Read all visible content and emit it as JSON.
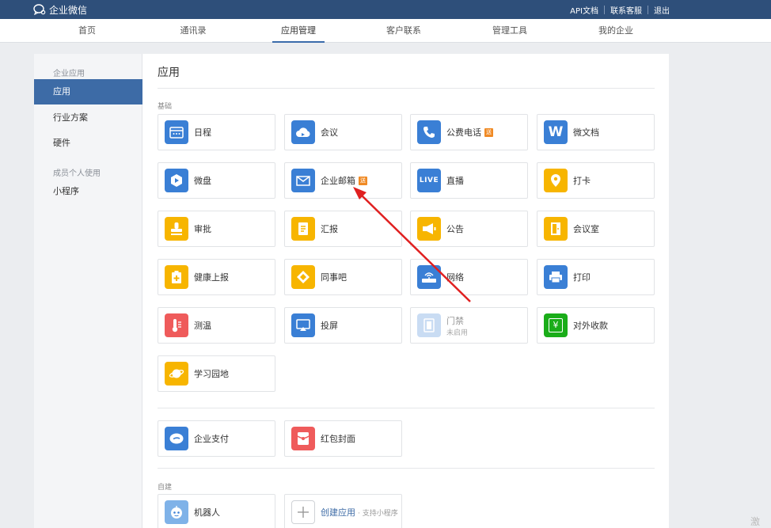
{
  "topbar": {
    "logo_text": "企业微信",
    "links": [
      "API文档",
      "联系客服",
      "退出"
    ]
  },
  "nav": {
    "tabs": [
      "首页",
      "通讯录",
      "应用管理",
      "客户联系",
      "管理工具",
      "我的企业"
    ],
    "active": "应用管理"
  },
  "sidebar": {
    "group1": "企业应用",
    "items1": [
      "应用",
      "行业方案",
      "硬件"
    ],
    "group2": "成员个人使用",
    "items2": [
      "小程序"
    ]
  },
  "content": {
    "title": "应用",
    "section_basic": "基础",
    "section_custom": "自建"
  },
  "apps": {
    "calendar": "日程",
    "meeting": "会议",
    "phone": "公费电话",
    "doc": "微文档",
    "disk": "微盘",
    "mail": "企业邮箱",
    "live": "直播",
    "checkin": "打卡",
    "approval": "审批",
    "report": "汇报",
    "notice": "公告",
    "room": "会议室",
    "health": "健康上报",
    "colleague": "同事吧",
    "network": "网络",
    "print": "打印",
    "temperature": "测温",
    "screen": "投屏",
    "door": "门禁",
    "door_status": "未启用",
    "payment_external": "对外收款",
    "learning": "学习园地",
    "pay": "企业支付",
    "redpacket": "红包封面",
    "robot": "机器人",
    "create": "创建应用",
    "create_desc": "· 支持小程序"
  },
  "badges": {
    "phone": "送",
    "mail": "送"
  },
  "icons": {
    "live_text": "LIVE",
    "doc_text": "W",
    "payment_text": "¥"
  },
  "colors": {
    "topbar": "#2e4f7a",
    "sidebar_active": "#3d6ba6",
    "blue_icon": "#3a7fd5",
    "yellow_icon": "#f7b500",
    "red_icon": "#ef5b5b",
    "green_icon": "#1aad19",
    "badge": "#f08a24",
    "arrow": "#e02020"
  }
}
